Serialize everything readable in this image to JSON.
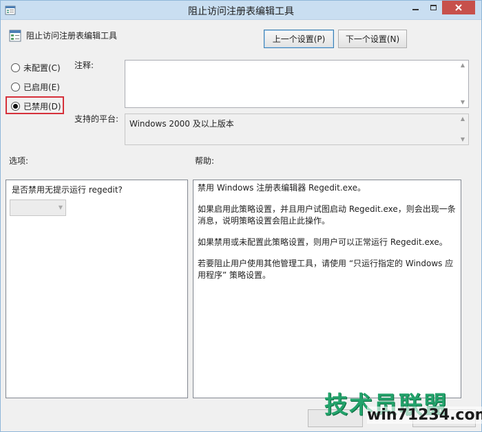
{
  "window": {
    "title": "阻止访问注册表编辑工具",
    "accent_titlebar": "#c9def1",
    "close_color": "#c7504b"
  },
  "header": {
    "policy_title": "阻止访问注册表编辑工具",
    "prev_button": "上一个设置(P)",
    "next_button": "下一个设置(N)"
  },
  "state": {
    "options": [
      {
        "label": "未配置(C)",
        "selected": false
      },
      {
        "label": "已启用(E)",
        "selected": false
      },
      {
        "label": "已禁用(D)",
        "selected": true
      }
    ],
    "highlight_color": "#d6303a"
  },
  "comment": {
    "label": "注释:",
    "value": ""
  },
  "platform": {
    "label": "支持的平台:",
    "value": "Windows 2000 及以上版本"
  },
  "options_section": {
    "label": "选项:",
    "question": "是否禁用无提示运行 regedit?",
    "combo_value": ""
  },
  "help_section": {
    "label": "帮助:",
    "paragraphs": [
      "禁用 Windows 注册表编辑器 Regedit.exe。",
      "如果启用此策略设置，并且用户试图启动 Regedit.exe，则会出现一条消息，说明策略设置会阻止此操作。",
      "如果禁用或未配置此策略设置，则用户可以正常运行 Regedit.exe。",
      "若要阻止用户使用其他管理工具，请使用 “只运行指定的 Windows 应用程序” 策略设置。"
    ]
  },
  "watermark": {
    "brand": "技术员联盟",
    "url": "win71234.com",
    "brand_color": "#23a26b"
  }
}
